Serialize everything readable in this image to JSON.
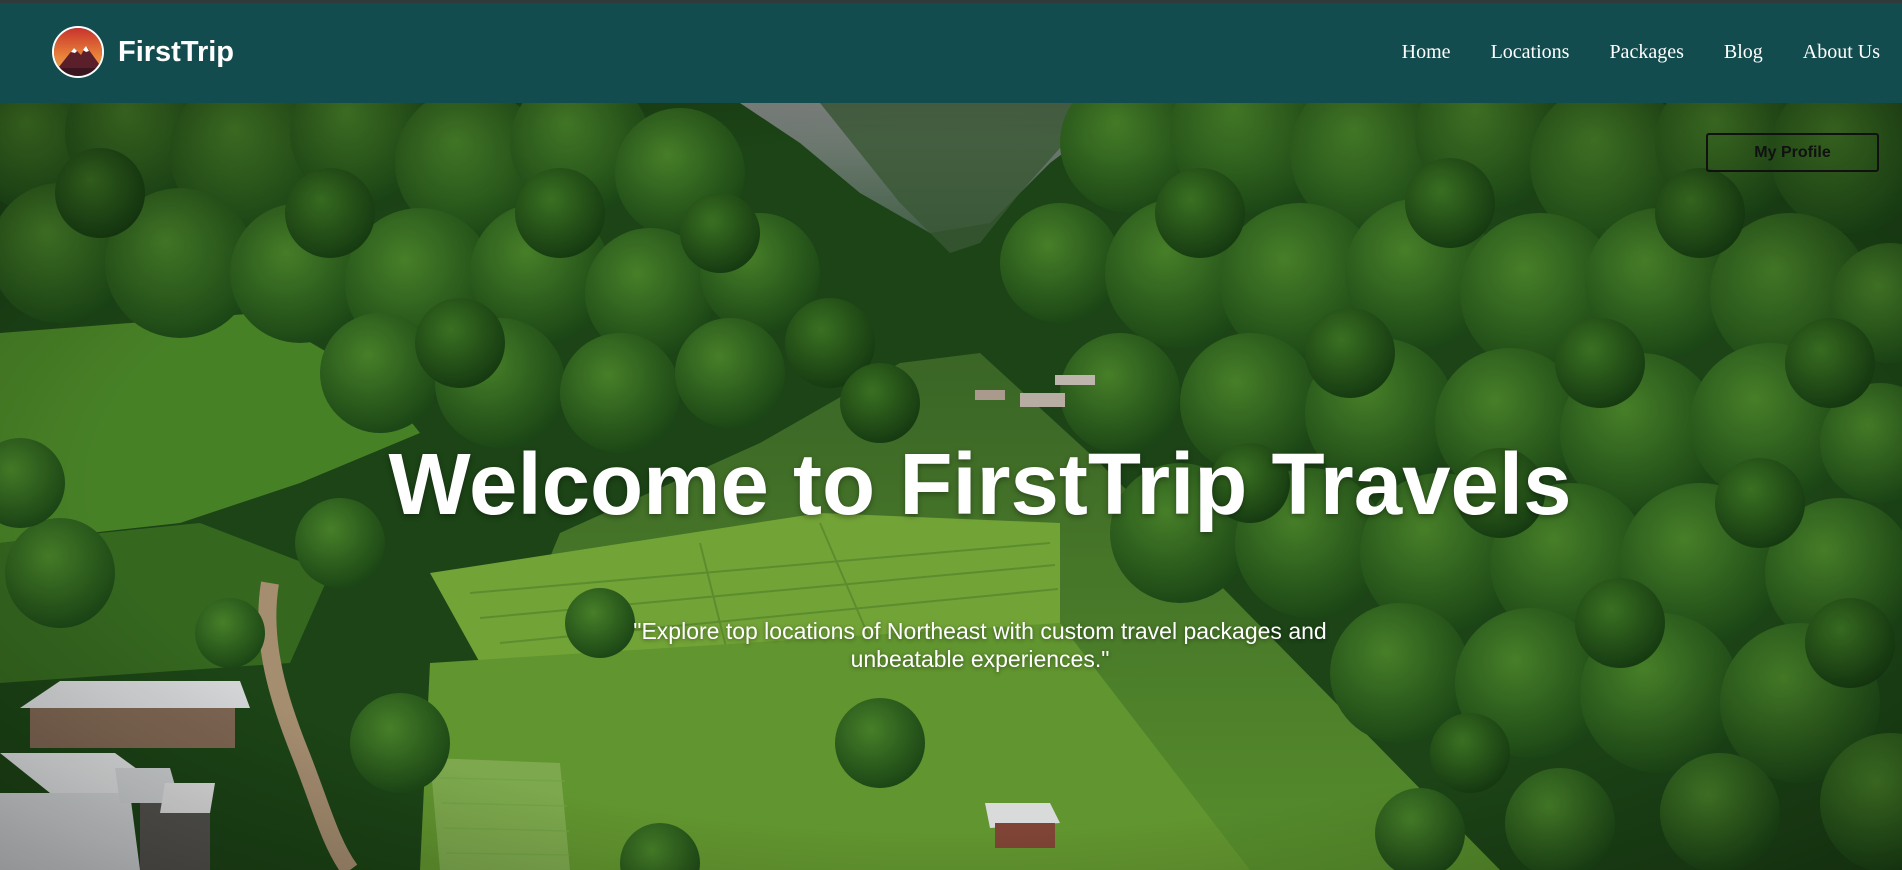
{
  "brand": {
    "name": "FirstTrip"
  },
  "nav": {
    "items": [
      {
        "label": "Home"
      },
      {
        "label": "Locations"
      },
      {
        "label": "Packages"
      },
      {
        "label": "Blog"
      },
      {
        "label": "About Us"
      }
    ]
  },
  "hero": {
    "profile_button": "My Profile",
    "title": "Welcome to FirstTrip Travels",
    "subtitle": "\"Explore top locations of Northeast with custom travel packages and unbeatable experiences.\""
  },
  "colors": {
    "navbar_bg": "#134c4e",
    "hero_text": "#ffffff",
    "forest_dark": "#1e4a1a",
    "field_green": "#6a9c32"
  }
}
